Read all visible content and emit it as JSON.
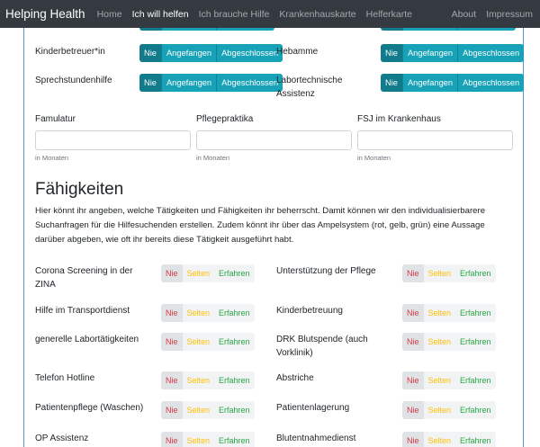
{
  "nav": {
    "brand": "Helping Health",
    "links": [
      "Home",
      "Ich will helfen",
      "Ich brauche Hilfe",
      "Krankenhauskarte",
      "Helferkarte"
    ],
    "right_links": [
      "About",
      "Impressum"
    ]
  },
  "status_options": [
    "Nie",
    "Angefangen",
    "Abgeschlossen"
  ],
  "qualifications": [
    {
      "label": "Kinderbetreuer*in"
    },
    {
      "label": "Hebamme"
    },
    {
      "label": "Sprechstundenhilfe"
    },
    {
      "label": "Labortechnische Assistenz"
    }
  ],
  "fields": [
    {
      "label": "Famulatur",
      "hint": "in Monaten"
    },
    {
      "label": "Pflegepraktika",
      "hint": "in Monaten"
    },
    {
      "label": "FSJ im Krankenhaus",
      "hint": "in Monaten"
    }
  ],
  "skills_section": {
    "title": "Fähigkeiten",
    "description": "Hier könnt ihr angeben, welche Tätigkeiten und Fähigkeiten ihr beherrscht. Damit können wir den individualisierbarere Suchanfragen für die Hilfesuchenden erstellen. Zudem könnt ihr über das Ampelsystem (rot, gelb, grün) eine Aussage darüber abgeben, wie oft ihr bereits diese Tätigkeit ausgeführt habt."
  },
  "experience_options": [
    "Nie",
    "Selten",
    "Erfahren"
  ],
  "skills": [
    {
      "label": "Corona Screening in der ZINA"
    },
    {
      "label": "Unterstützung der Pflege"
    },
    {
      "label": "Hilfe im Transportdienst"
    },
    {
      "label": "Kinderbetreuung"
    },
    {
      "label": "generelle Labortätigkeiten"
    },
    {
      "label": "DRK Blutspende (auch Vorklinik)"
    },
    {
      "label": "Telefon Hotline"
    },
    {
      "label": "Abstriche"
    },
    {
      "label": "Patientenpflege (Waschen)"
    },
    {
      "label": "Patientenlagerung"
    },
    {
      "label": "OP Assistenz"
    },
    {
      "label": "Blutentnahmedienst"
    }
  ]
}
